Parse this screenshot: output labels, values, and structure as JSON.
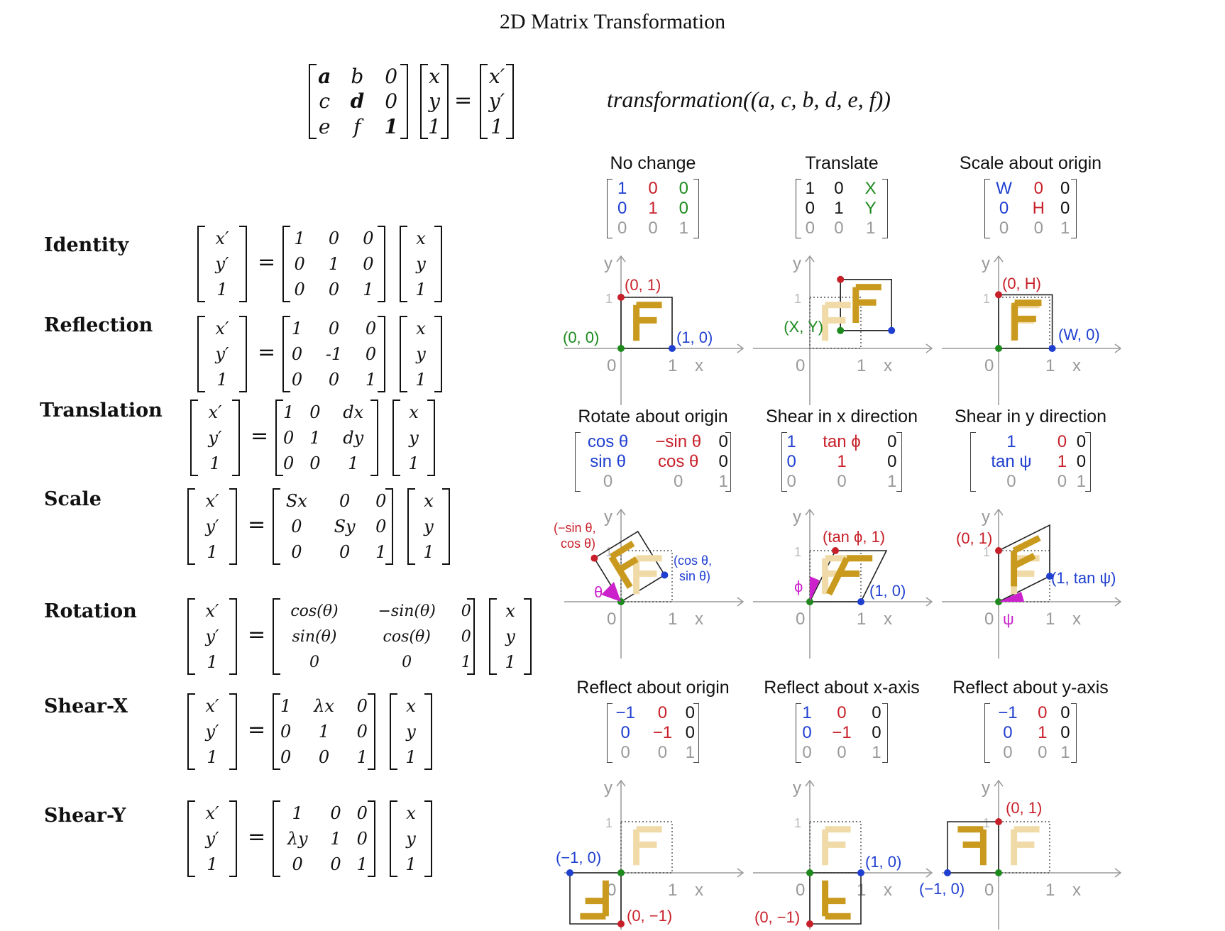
{
  "title": "2D Matrix Transformation",
  "general": {
    "matrix": [
      [
        "a",
        "b",
        "0"
      ],
      [
        "c",
        "d",
        "0"
      ],
      [
        "e",
        "f",
        "1"
      ]
    ],
    "vec_in": [
      "x",
      "y",
      "1"
    ],
    "vec_out": [
      "x′",
      "y′",
      "1"
    ],
    "eq": "=",
    "formula": "transformation((a, c, b, d, e, f))"
  },
  "left": {
    "vec_out": [
      "x′",
      "y′",
      "1"
    ],
    "vec_in": [
      "x",
      "y",
      "1"
    ],
    "rows": [
      {
        "label": "Identity",
        "m": [
          [
            "1",
            "0",
            "0"
          ],
          [
            "0",
            "1",
            "0"
          ],
          [
            "0",
            "0",
            "1"
          ]
        ]
      },
      {
        "label": "Reflection",
        "m": [
          [
            "1",
            "0",
            "0"
          ],
          [
            "0",
            "-1",
            "0"
          ],
          [
            "0",
            "0",
            "1"
          ]
        ]
      },
      {
        "label": "Translation",
        "m": [
          [
            "1",
            "0",
            "dx"
          ],
          [
            "0",
            "1",
            "dy"
          ],
          [
            "0",
            "0",
            "1"
          ]
        ]
      },
      {
        "label": "Scale",
        "m": [
          [
            "Sx",
            "0",
            "0"
          ],
          [
            "0",
            "Sy",
            "0"
          ],
          [
            "0",
            "0",
            "1"
          ]
        ]
      },
      {
        "label": "Rotation",
        "m": [
          [
            "cos(θ)",
            "−sin(θ)",
            "0"
          ],
          [
            "sin(θ)",
            "cos(θ)",
            "0"
          ],
          [
            "0",
            "0",
            "1"
          ]
        ]
      },
      {
        "label": "Shear-X",
        "m": [
          [
            "1",
            "λx",
            "0"
          ],
          [
            "0",
            "1",
            "0"
          ],
          [
            "0",
            "0",
            "1"
          ]
        ]
      },
      {
        "label": "Shear-Y",
        "m": [
          [
            "1",
            "0",
            "0"
          ],
          [
            "λy",
            "1",
            "0"
          ],
          [
            "0",
            "0",
            "1"
          ]
        ]
      }
    ]
  },
  "colors": {
    "red": "#c8202a",
    "blue": "#1f3fd0",
    "green": "#1e8a1e",
    "gray": "#9a9a9a",
    "gold": "#c99a1d",
    "magenta": "#cc22cc"
  },
  "panels": [
    {
      "title": "No change",
      "m": [
        [
          "1",
          "0",
          "0"
        ],
        [
          "0",
          "1",
          "0"
        ],
        [
          "0",
          "0",
          "1"
        ]
      ],
      "mc": [
        [
          "b",
          "r",
          "g"
        ],
        [
          "b",
          "r",
          "g"
        ],
        [
          "k",
          "k",
          "k"
        ]
      ],
      "labels": [
        "(0, 1)",
        "(0, 0)",
        "(1, 0)"
      ]
    },
    {
      "title": "Translate",
      "m": [
        [
          "1",
          "0",
          "X"
        ],
        [
          "0",
          "1",
          "Y"
        ],
        [
          "0",
          "0",
          "1"
        ]
      ],
      "mc": [
        [
          "d",
          "d",
          "g"
        ],
        [
          "d",
          "d",
          "g"
        ],
        [
          "k",
          "k",
          "k"
        ]
      ],
      "labels": [
        "(X, Y)"
      ]
    },
    {
      "title": "Scale about origin",
      "m": [
        [
          "W",
          "0",
          "0"
        ],
        [
          "0",
          "H",
          "0"
        ],
        [
          "0",
          "0",
          "1"
        ]
      ],
      "mc": [
        [
          "b",
          "r",
          "d"
        ],
        [
          "b",
          "r",
          "d"
        ],
        [
          "k",
          "k",
          "k"
        ]
      ],
      "labels": [
        "(0, H)",
        "(W, 0)"
      ]
    },
    {
      "title": "Rotate about origin",
      "m": [
        [
          "cos θ",
          "−sin θ",
          "0"
        ],
        [
          "sin θ",
          "cos θ",
          "0"
        ],
        [
          "0",
          "0",
          "1"
        ]
      ],
      "mc": [
        [
          "b",
          "r",
          "d"
        ],
        [
          "b",
          "r",
          "d"
        ],
        [
          "k",
          "k",
          "k"
        ]
      ],
      "labels": [
        "(−sin θ,",
        "cos θ)",
        "(cos θ,",
        "sin θ)",
        "θ"
      ]
    },
    {
      "title": "Shear in x direction",
      "m": [
        [
          "1",
          "tan ϕ",
          "0"
        ],
        [
          "0",
          "1",
          "0"
        ],
        [
          "0",
          "0",
          "1"
        ]
      ],
      "mc": [
        [
          "b",
          "r",
          "d"
        ],
        [
          "b",
          "r",
          "d"
        ],
        [
          "k",
          "k",
          "k"
        ]
      ],
      "labels": [
        "(tan ϕ, 1)",
        "(1, 0)",
        "ϕ"
      ]
    },
    {
      "title": "Shear in y direction",
      "m": [
        [
          "1",
          "0",
          "0"
        ],
        [
          "tan ψ",
          "1",
          "0"
        ],
        [
          "0",
          "0",
          "1"
        ]
      ],
      "mc": [
        [
          "b",
          "r",
          "d"
        ],
        [
          "b",
          "r",
          "d"
        ],
        [
          "k",
          "k",
          "k"
        ]
      ],
      "labels": [
        "(0, 1)",
        "(1, tan ψ)",
        "ψ"
      ]
    },
    {
      "title": "Reflect about origin",
      "m": [
        [
          "−1",
          "0",
          "0"
        ],
        [
          "0",
          "−1",
          "0"
        ],
        [
          "0",
          "0",
          "1"
        ]
      ],
      "mc": [
        [
          "b",
          "r",
          "d"
        ],
        [
          "b",
          "r",
          "d"
        ],
        [
          "k",
          "k",
          "k"
        ]
      ],
      "labels": [
        "(−1, 0)",
        "(0, −1)"
      ]
    },
    {
      "title": "Reflect about x-axis",
      "m": [
        [
          "1",
          "0",
          "0"
        ],
        [
          "0",
          "−1",
          "0"
        ],
        [
          "0",
          "0",
          "1"
        ]
      ],
      "mc": [
        [
          "b",
          "r",
          "d"
        ],
        [
          "b",
          "r",
          "d"
        ],
        [
          "k",
          "k",
          "k"
        ]
      ],
      "labels": [
        "(1, 0)",
        "(0, −1)"
      ]
    },
    {
      "title": "Reflect about y-axis",
      "m": [
        [
          "−1",
          "0",
          "0"
        ],
        [
          "0",
          "1",
          "0"
        ],
        [
          "0",
          "0",
          "1"
        ]
      ],
      "mc": [
        [
          "b",
          "r",
          "d"
        ],
        [
          "b",
          "r",
          "d"
        ],
        [
          "k",
          "k",
          "k"
        ]
      ],
      "labels": [
        "(0, 1)",
        "(−1, 0)"
      ]
    }
  ],
  "axis": {
    "x": "x",
    "y": "y",
    "zero": "0",
    "one": "1"
  }
}
